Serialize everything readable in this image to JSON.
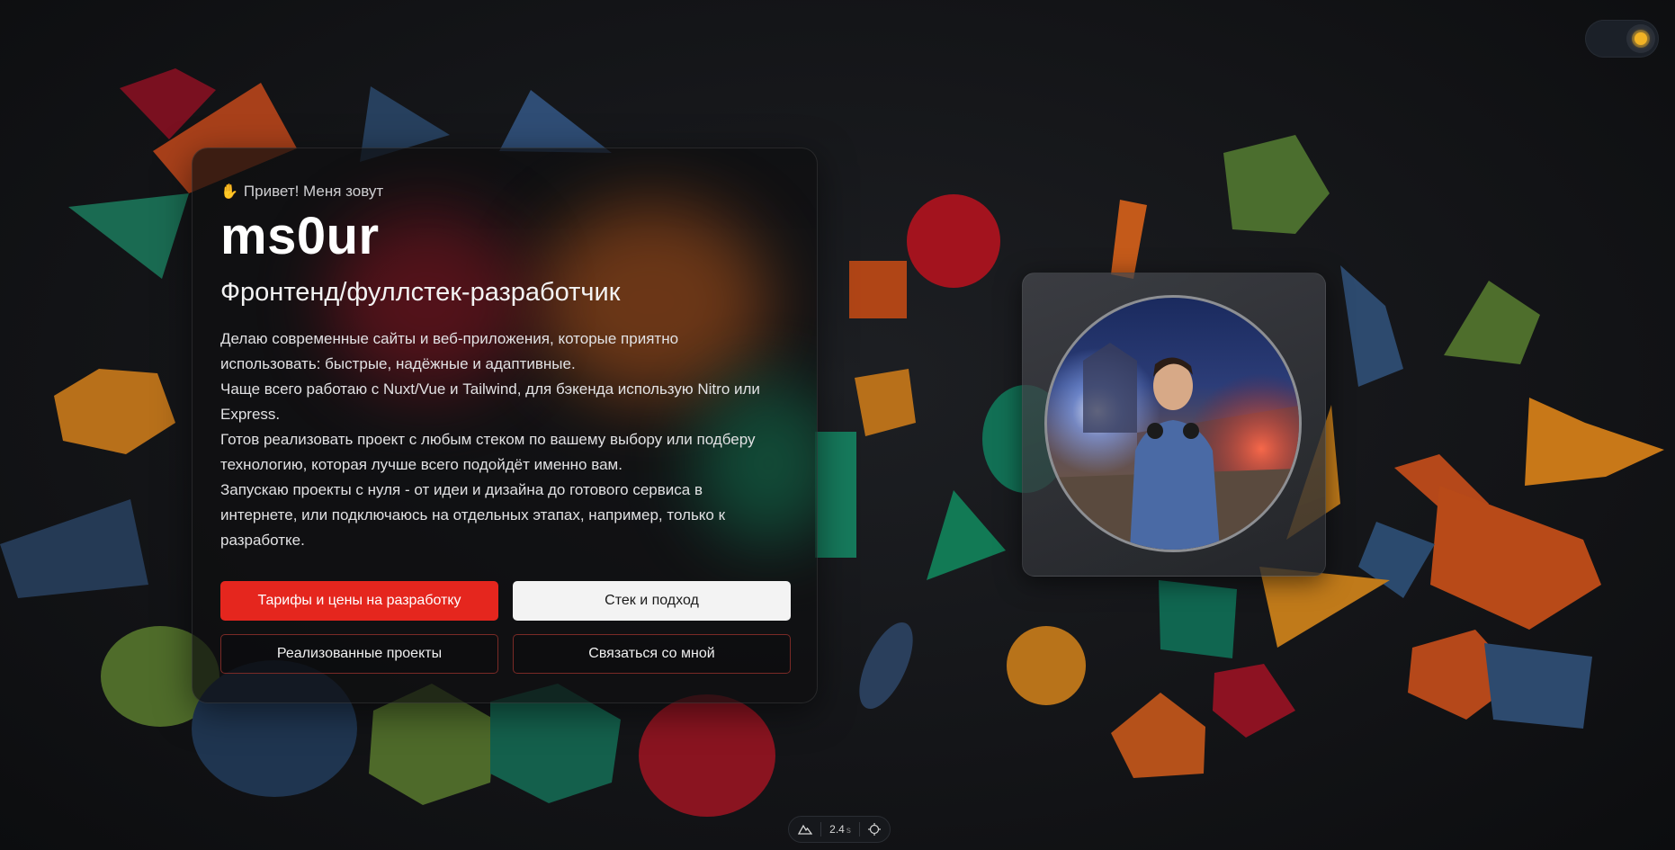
{
  "theme_toggle": {
    "icon": "sun-icon",
    "color": "#f2b325"
  },
  "intro": {
    "greeting_icon": "waving-hand-icon",
    "greeting": "Привет! Меня зовут",
    "name": "ms0ur",
    "role": "Фронтенд/фуллстек-разработчик",
    "bio": [
      "Делаю современные сайты и веб-приложения, которые приятно использовать: быстрые, надёжные и адаптивные.",
      "Чаще всего работаю с Nuxt/Vue и Tailwind, для бэкенда использую Nitro или Express.",
      "Готов реализовать проект с любым стеком по вашему выбору или подберу технологию, которая лучше всего подойдёт именно вам.",
      "Запускаю проекты с нуля - от идеи и дизайна до готового сервиса в интернете, или подключаюсь на отдельных этапах, например, только к разработке."
    ],
    "buttons": {
      "prices": "Тарифы и цены на разработку",
      "stack": "Стек и подход",
      "projects": "Реализованные проекты",
      "contact": "Связаться со мной"
    }
  },
  "avatar": {
    "icon": "profile-photo"
  },
  "devbar": {
    "logo_icon": "nuxt-logo-icon",
    "time": "2.4",
    "time_unit": "s",
    "inspect_icon": "crosshair-icon"
  },
  "colors": {
    "accent": "#e5261e",
    "background": "#101114"
  }
}
